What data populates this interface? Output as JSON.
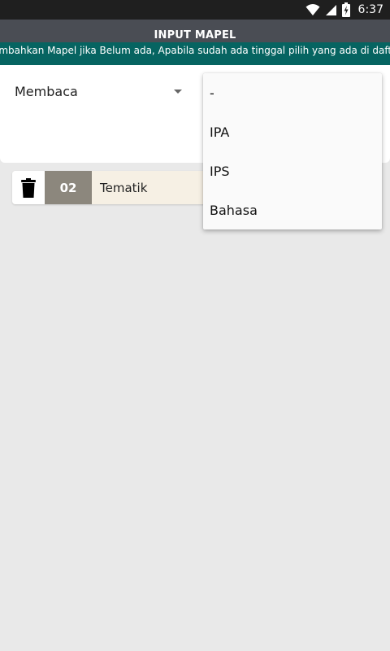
{
  "status_bar": {
    "time": "6:37",
    "icons": [
      "wifi-icon",
      "signal-icon",
      "battery-icon"
    ]
  },
  "app_bar": {
    "title": "INPUT MAPEL"
  },
  "banner": {
    "text": "Tambahkan Mapel jika Belum ada, Apabila sudah ada tinggal pilih yang ada di daftar"
  },
  "form": {
    "kelas_spinner_value": "Membaca"
  },
  "mapel_list": [
    {
      "code": "02",
      "name": "Tematik",
      "delete_icon": "trash-icon"
    }
  ],
  "dropdown": {
    "options": [
      "-",
      "IPA",
      "IPS",
      "Bahasa"
    ]
  },
  "colors": {
    "status_bar": "#1f1f1f",
    "title_bar": "#4a4d54",
    "banner": "#066461",
    "code_cell": "#8c877d",
    "row_background": "#f6f0e4",
    "page_background": "#e9e9e9"
  }
}
